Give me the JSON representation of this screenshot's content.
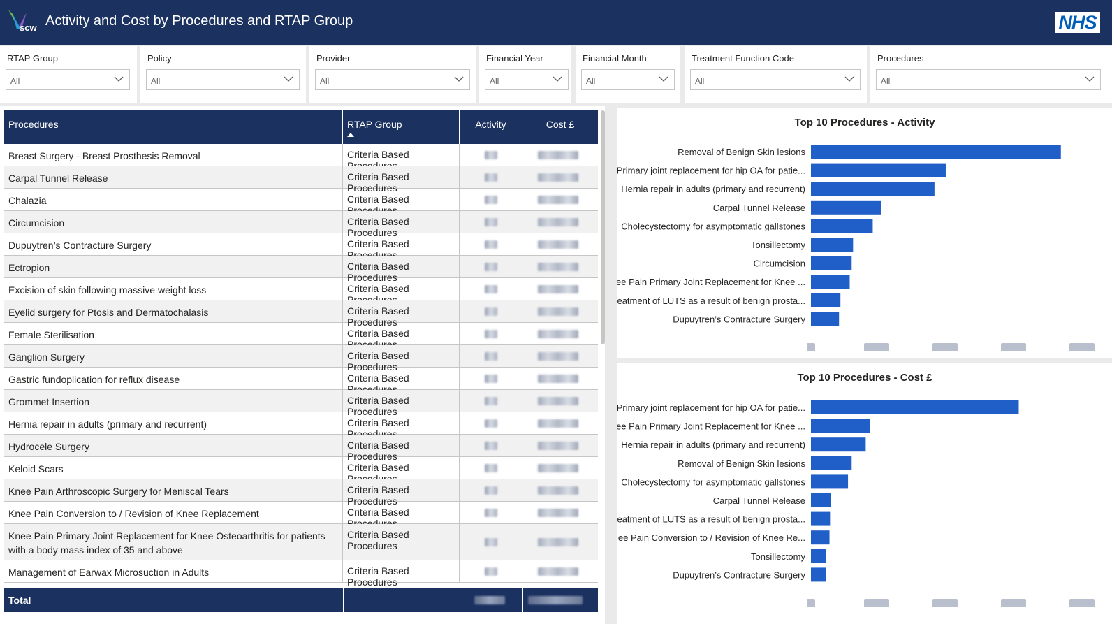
{
  "header": {
    "logo_text": "scw",
    "title": "Activity and Cost by Procedures and RTAP Group",
    "nhs_logo": "NHS"
  },
  "slicers": [
    {
      "label": "RTAP Group",
      "value": "All"
    },
    {
      "label": "Policy",
      "value": "All"
    },
    {
      "label": "Provider",
      "value": "All"
    },
    {
      "label": "Financial Year",
      "value": "All"
    },
    {
      "label": "Financial Month",
      "value": "All"
    },
    {
      "label": "Treatment Function Code",
      "value": "All"
    },
    {
      "label": "Procedures",
      "value": "All"
    }
  ],
  "table": {
    "columns": [
      "Procedures",
      "RTAP Group",
      "Activity",
      "Cost £"
    ],
    "rows": [
      {
        "procedure": "Breast Surgery - Breast Prosthesis Removal",
        "group": "Criteria Based Procedures"
      },
      {
        "procedure": "Carpal Tunnel Release",
        "group": "Criteria Based Procedures"
      },
      {
        "procedure": "Chalazia",
        "group": "Criteria Based Procedures"
      },
      {
        "procedure": "Circumcision",
        "group": "Criteria Based Procedures"
      },
      {
        "procedure": "Dupuytren’s Contracture Surgery",
        "group": "Criteria Based Procedures"
      },
      {
        "procedure": "Ectropion",
        "group": "Criteria Based Procedures"
      },
      {
        "procedure": "Excision of skin following massive weight loss",
        "group": "Criteria Based Procedures"
      },
      {
        "procedure": "Eyelid surgery for Ptosis and Dermatochalasis",
        "group": "Criteria Based Procedures"
      },
      {
        "procedure": "Female Sterilisation",
        "group": "Criteria Based Procedures"
      },
      {
        "procedure": "Ganglion Surgery",
        "group": "Criteria Based Procedures"
      },
      {
        "procedure": "Gastric fundoplication for reflux disease",
        "group": "Criteria Based Procedures"
      },
      {
        "procedure": "Grommet Insertion",
        "group": "Criteria Based Procedures"
      },
      {
        "procedure": "Hernia repair in adults (primary and recurrent)",
        "group": "Criteria Based Procedures"
      },
      {
        "procedure": "Hydrocele Surgery",
        "group": "Criteria Based Procedures"
      },
      {
        "procedure": "Keloid Scars",
        "group": "Criteria Based Procedures"
      },
      {
        "procedure": "Knee Pain Arthroscopic Surgery for Meniscal Tears",
        "group": "Criteria Based Procedures"
      },
      {
        "procedure": "Knee Pain Conversion to / Revision of Knee Replacement",
        "group": "Criteria Based Procedures"
      },
      {
        "procedure": "Knee Pain Primary Joint Replacement for Knee Osteoarthritis for patients with a body mass index of 35 and above",
        "group": "Criteria Based Procedures"
      },
      {
        "procedure": "Management of Earwax Microsuction in Adults",
        "group": "Criteria Based Procedures"
      }
    ],
    "total_label": "Total"
  },
  "chart_data": [
    {
      "type": "bar",
      "orientation": "horizontal",
      "title": "Top 10 Procedures - Activity",
      "categories": [
        "Removal of Benign Skin lesions",
        "Primary joint replacement for hip OA for patie...",
        "Hernia repair in adults (primary and recurrent)",
        "Carpal Tunnel Release",
        "Cholecystectomy for asymptomatic gallstones",
        "Tonsillectomy",
        "Circumcision",
        "Knee Pain Primary Joint Replacement for Knee ...",
        "Treatment of LUTS as a result of benign prosta...",
        "Dupuytren’s Contracture Surgery"
      ],
      "values": [
        0.89,
        0.48,
        0.44,
        0.25,
        0.22,
        0.15,
        0.145,
        0.138,
        0.105,
        0.1
      ],
      "color": "#1f5fc7",
      "xlim": [
        0,
        1
      ]
    },
    {
      "type": "bar",
      "orientation": "horizontal",
      "title": "Top 10 Procedures - Cost £",
      "categories": [
        "Primary joint replacement for hip OA for patie...",
        "Knee Pain Primary Joint Replacement for Knee ...",
        "Hernia repair in adults (primary and recurrent)",
        "Removal of Benign Skin lesions",
        "Cholecystectomy for asymptomatic gallstones",
        "Carpal Tunnel Release",
        "Treatment of LUTS as a result of benign prosta...",
        "Knee Pain Conversion to / Revision of Knee Re...",
        "Tonsillectomy",
        "Dupuytren’s Contracture Surgery"
      ],
      "values": [
        0.74,
        0.21,
        0.195,
        0.145,
        0.132,
        0.07,
        0.068,
        0.066,
        0.054,
        0.053
      ],
      "color": "#1f5fc7",
      "xlim": [
        0,
        1
      ]
    }
  ]
}
